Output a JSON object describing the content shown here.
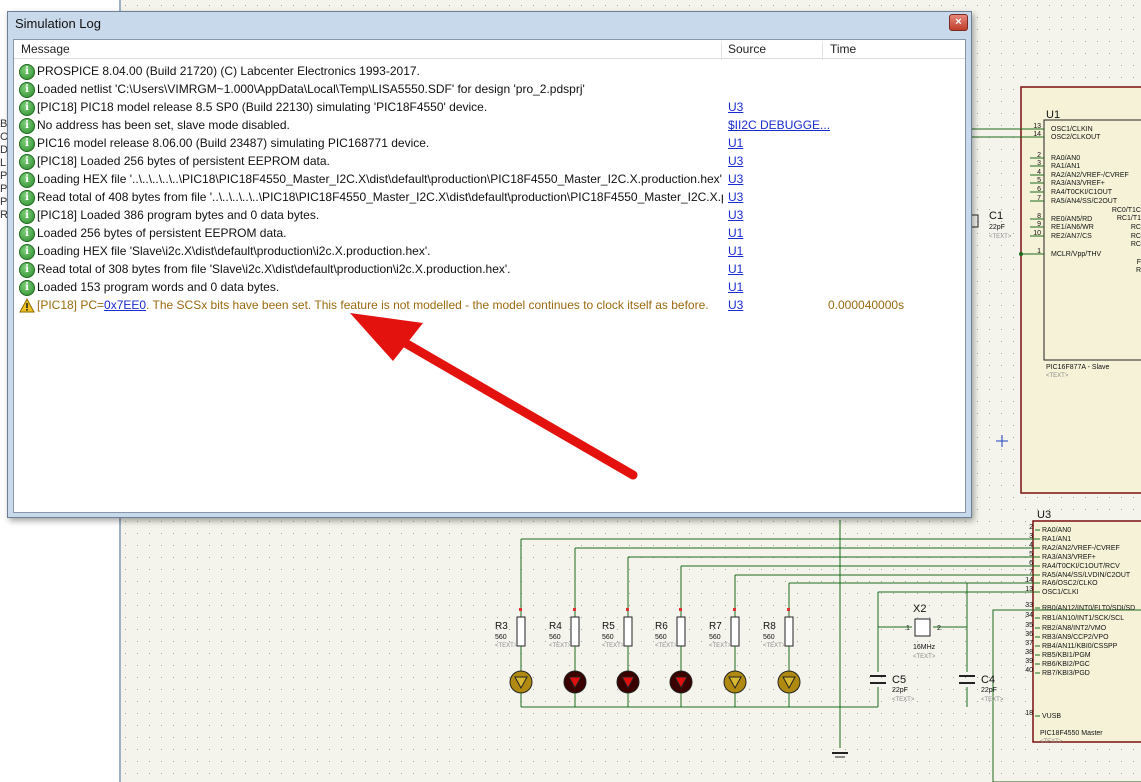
{
  "window": {
    "title": "Simulation Log",
    "close_glyph": "×"
  },
  "columns": {
    "message": "Message",
    "source": "Source",
    "time": "Time"
  },
  "rows": [
    {
      "type": "info",
      "message": "PROSPICE 8.04.00 (Build 21720) (C) Labcenter Electronics 1993-2017.",
      "source": "",
      "time": ""
    },
    {
      "type": "info",
      "message": "Loaded netlist 'C:\\Users\\VIMRGM~1.000\\AppData\\Local\\Temp\\LISA5550.SDF' for design 'pro_2.pdsprj'",
      "source": "",
      "time": ""
    },
    {
      "type": "info",
      "message": "[PIC18] PIC18 model release 8.5 SP0 (Build 22130) simulating 'PIC18F4550' device.",
      "source": "U3",
      "time": ""
    },
    {
      "type": "info",
      "message": "No address has been set, slave mode disabled.",
      "source": "$II2C DEBUGGE...",
      "time": ""
    },
    {
      "type": "info",
      "message": "PIC16 model release 8.06.00 (Build 23487) simulating PIC168771 device.",
      "source": "U1",
      "time": ""
    },
    {
      "type": "info",
      "message": "[PIC18] Loaded 256 bytes of persistent EEPROM data.",
      "source": "U3",
      "time": ""
    },
    {
      "type": "info",
      "message": "Loading HEX file '..\\..\\..\\..\\..\\PIC18\\PIC18F4550_Master_I2C.X\\dist\\default\\production\\PIC18F4550_Master_I2C.X.production.hex'.",
      "source": "U3",
      "time": ""
    },
    {
      "type": "info",
      "message": "Read total of 408 bytes from file '..\\..\\..\\..\\..\\PIC18\\PIC18F4550_Master_I2C.X\\dist\\default\\production\\PIC18F4550_Master_I2C.X.productio...",
      "source": "U3",
      "time": ""
    },
    {
      "type": "info",
      "message": "[PIC18] Loaded 386 program bytes and 0 data bytes.",
      "source": "U3",
      "time": ""
    },
    {
      "type": "info",
      "message": "Loaded 256 bytes of persistent EEPROM data.",
      "source": "U1",
      "time": ""
    },
    {
      "type": "info",
      "message": "Loading HEX file 'Slave\\i2c.X\\dist\\default\\production\\i2c.X.production.hex'.",
      "source": "U1",
      "time": ""
    },
    {
      "type": "info",
      "message": "Read total of 308 bytes from file 'Slave\\i2c.X\\dist\\default\\production\\i2c.X.production.hex'.",
      "source": "U1",
      "time": ""
    },
    {
      "type": "info",
      "message": "Loaded 153 program words and 0 data bytes.",
      "source": "U1",
      "time": ""
    },
    {
      "type": "warning",
      "message_prefix": "[PIC18] PC=",
      "pc": "0x7EE0",
      "message_suffix": ". The SCSx bits have been set. This feature is not modelled - the model continues to clock itself as before.",
      "source": "U3",
      "time": "0.000040000s"
    }
  ],
  "left_panel_letters": [
    "B",
    "C",
    "D",
    "L",
    "P",
    "P",
    "P",
    "R"
  ],
  "schematic": {
    "u1_ref": "U1",
    "u1_name": "PIC16F877A - Slave",
    "u1_text": "<TEXT>",
    "u1_pins_left": [
      {
        "num": "13",
        "name": "OSC1/CLKIN"
      },
      {
        "num": "14",
        "name": "OSC2/CLKOUT"
      },
      {
        "num": "2",
        "name": "RA0/AN0"
      },
      {
        "num": "3",
        "name": "RA1/AN1"
      },
      {
        "num": "4",
        "name": "RA2/AN2/VREF-/CVREF"
      },
      {
        "num": "5",
        "name": "RA3/AN3/VREF+"
      },
      {
        "num": "6",
        "name": "RA4/T0CKI/C1OUT"
      },
      {
        "num": "7",
        "name": "RA5/AN4/SS/C2OUT"
      },
      {
        "num": "8",
        "name": "RE0/AN5/RD"
      },
      {
        "num": "9",
        "name": "RE1/AN6/WR"
      },
      {
        "num": "10",
        "name": "RE2/AN7/CS"
      },
      {
        "num": "1",
        "name": "MCLR/Vpp/THV"
      }
    ],
    "u1_right_frags": [
      "RC0/T1C",
      "RC1/T1",
      "RC",
      "RC",
      "RC",
      "F",
      "R"
    ],
    "c1_ref": "C1",
    "c1_val": "22pF",
    "c1_text": "<TEXT>",
    "u3_ref": "U3",
    "u3_name": "PIC18F4550 Master",
    "u3_text": "<TEXT>",
    "u3_pins_left": [
      {
        "num": "2",
        "name": "RA0/AN0"
      },
      {
        "num": "3",
        "name": "RA1/AN1"
      },
      {
        "num": "4",
        "name": "RA2/AN2/VREF-/CVREF"
      },
      {
        "num": "5",
        "name": "RA3/AN3/VREF+"
      },
      {
        "num": "6",
        "name": "RA4/T0CKI/C1OUT/RCV"
      },
      {
        "num": "7",
        "name": "RA5/AN4/SS/LVDIN/C2OUT"
      },
      {
        "num": "14",
        "name": "RA6/OSC2/CLKO"
      },
      {
        "num": "13",
        "name": "OSC1/CLKI"
      },
      {
        "num": "33",
        "name": "RB0/AN12/INT0/FLT0/SDI/SD"
      },
      {
        "num": "34",
        "name": "RB1/AN10/INT1/SCK/SCL"
      },
      {
        "num": "35",
        "name": "RB2/AN8/INT2/VMO"
      },
      {
        "num": "36",
        "name": "RB3/AN9/CCP2/VPO"
      },
      {
        "num": "37",
        "name": "RB4/AN11/KBI0/CSSPP"
      },
      {
        "num": "38",
        "name": "RB5/KBI1/PGM"
      },
      {
        "num": "39",
        "name": "RB6/KBI2/PGC"
      },
      {
        "num": "40",
        "name": "RB7/KBI3/PGD"
      },
      {
        "num": "18",
        "name": "VUSB"
      }
    ],
    "resistors": [
      {
        "ref": "R3",
        "val": "560"
      },
      {
        "ref": "R4",
        "val": "560"
      },
      {
        "ref": "R5",
        "val": "560"
      },
      {
        "ref": "R6",
        "val": "560"
      },
      {
        "ref": "R7",
        "val": "560"
      },
      {
        "ref": "R8",
        "val": "560"
      }
    ],
    "led_states": [
      "off",
      "on",
      "on",
      "on",
      "off",
      "off"
    ],
    "resistor_text": "<TEXT>",
    "x2_ref": "X2",
    "x2_val": "16MHz",
    "x2_text": "<TEXT>",
    "x2_pin1": "1",
    "x2_pin2": "2",
    "c5_ref": "C5",
    "c5_val": "22pF",
    "c5_text": "<TEXT>",
    "c4_ref": "C4",
    "c4_val": "22pF",
    "c4_text": "<TEXT>"
  },
  "colors": {
    "info": "#2a8a2a",
    "warning_text": "#9a6a10",
    "link": "#1a2bd0",
    "arrow": "#e4120e",
    "wire": "#1b6b1b",
    "chip_border": "#7a1010"
  }
}
